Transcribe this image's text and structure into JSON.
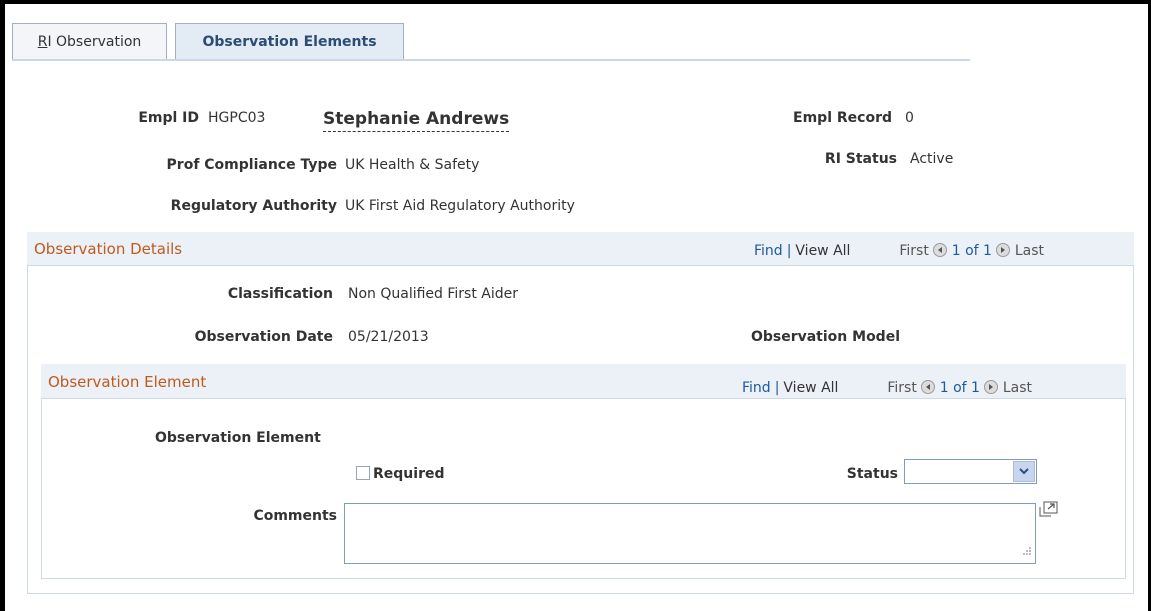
{
  "tabs": [
    {
      "label": "RI Observation"
    },
    {
      "label": "Observation Elements"
    }
  ],
  "header": {
    "empl_id_label": "Empl ID",
    "empl_id_value": "HGPC03",
    "employee_name": "Stephanie Andrews",
    "empl_record_label": "Empl Record",
    "empl_record_value": "0",
    "prof_compliance_label": "Prof Compliance Type",
    "prof_compliance_value": "UK Health & Safety",
    "ri_status_label": "RI Status",
    "ri_status_value": "Active",
    "regulatory_authority_label": "Regulatory Authority",
    "regulatory_authority_value": "UK First Aid Regulatory Authority"
  },
  "observation_details": {
    "title": "Observation Details",
    "nav": {
      "find": "Find",
      "separator": "|",
      "view_all": "View All",
      "first": "First",
      "count": "1 of 1",
      "last": "Last"
    },
    "classification_label": "Classification",
    "classification_value": "Non Qualified First Aider",
    "observation_date_label": "Observation Date",
    "observation_date_value": "05/21/2013",
    "observation_model_label": "Observation Model"
  },
  "observation_element": {
    "title": "Observation Element",
    "nav": {
      "find": "Find",
      "separator": "|",
      "view_all": "View All",
      "first": "First",
      "count": "1 of 1",
      "last": "Last"
    },
    "element_label": "Observation Element",
    "required_label": "Required",
    "required_checked": false,
    "status_label": "Status",
    "status_value": "",
    "comments_label": "Comments",
    "comments_value": ""
  },
  "icons": {
    "first_button": "previous-circle-icon",
    "last_button": "next-circle-icon",
    "dropdown": "chevron-down-icon",
    "expand": "expand-popup-icon",
    "resize": "resize-grip-icon"
  },
  "colors": {
    "section_title": "#c05a1c",
    "link": "#1c5a9c",
    "section_header_bg": "#ecf1f8",
    "active_tab_bg": "#e3ebf5"
  }
}
